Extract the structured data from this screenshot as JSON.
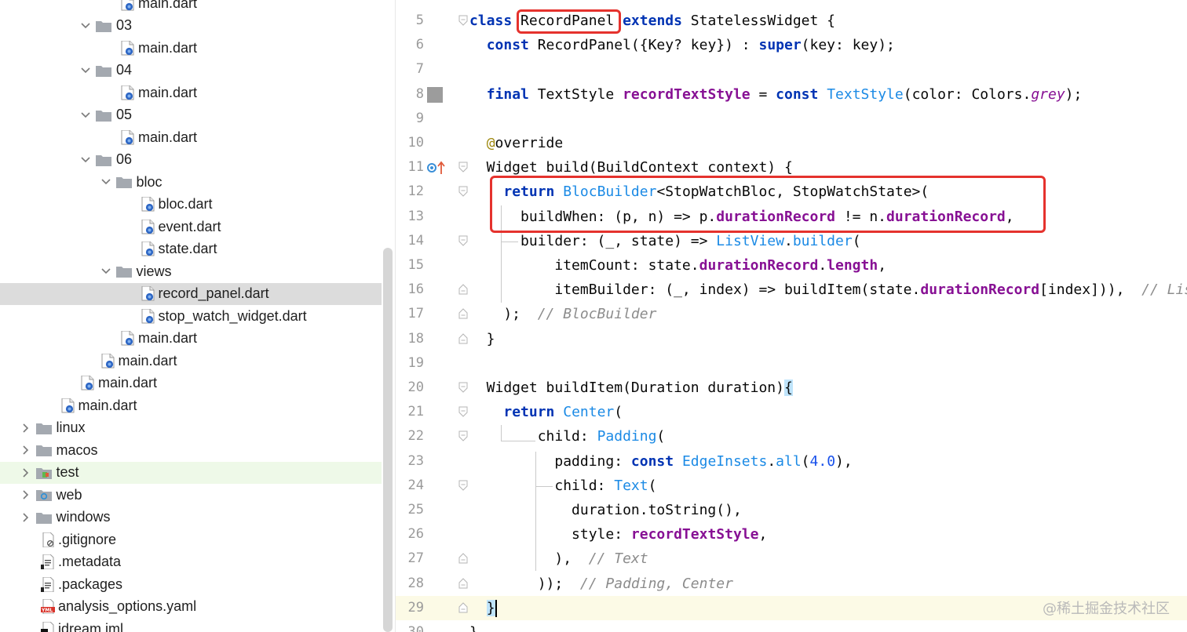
{
  "project_tree": {
    "items": [
      {
        "label": "main.dart",
        "type": "dart",
        "depth": 6
      },
      {
        "label": "03",
        "type": "folder",
        "depth": 4,
        "expanded": true
      },
      {
        "label": "main.dart",
        "type": "dart",
        "depth": 6
      },
      {
        "label": "04",
        "type": "folder",
        "depth": 4,
        "expanded": true
      },
      {
        "label": "main.dart",
        "type": "dart",
        "depth": 6
      },
      {
        "label": "05",
        "type": "folder",
        "depth": 4,
        "expanded": true
      },
      {
        "label": "main.dart",
        "type": "dart",
        "depth": 6
      },
      {
        "label": "06",
        "type": "folder",
        "depth": 4,
        "expanded": true
      },
      {
        "label": "bloc",
        "type": "folder",
        "depth": 5,
        "expanded": true
      },
      {
        "label": "bloc.dart",
        "type": "dart",
        "depth": 7
      },
      {
        "label": "event.dart",
        "type": "dart",
        "depth": 7
      },
      {
        "label": "state.dart",
        "type": "dart",
        "depth": 7
      },
      {
        "label": "views",
        "type": "folder",
        "depth": 5,
        "expanded": true
      },
      {
        "label": "record_panel.dart",
        "type": "dart",
        "depth": 7,
        "selected": true
      },
      {
        "label": "stop_watch_widget.dart",
        "type": "dart",
        "depth": 7
      },
      {
        "label": "main.dart",
        "type": "dart",
        "depth": 6
      },
      {
        "label": "main.dart",
        "type": "dart",
        "depth": 5
      },
      {
        "label": "main.dart",
        "type": "dart",
        "depth": 4
      },
      {
        "label": "main.dart",
        "type": "dart",
        "depth": 3
      },
      {
        "label": "linux",
        "type": "folder",
        "depth": 1,
        "expanded": false
      },
      {
        "label": "macos",
        "type": "folder",
        "depth": 1,
        "expanded": false
      },
      {
        "label": "test",
        "type": "test-folder",
        "depth": 1,
        "expanded": false,
        "highlighted": true
      },
      {
        "label": "web",
        "type": "web-folder",
        "depth": 1,
        "expanded": false
      },
      {
        "label": "windows",
        "type": "folder",
        "depth": 1,
        "expanded": false
      },
      {
        "label": ".gitignore",
        "type": "ignore-file",
        "depth": 2
      },
      {
        "label": ".metadata",
        "type": "text-file",
        "depth": 2
      },
      {
        "label": ".packages",
        "type": "text-file",
        "depth": 2
      },
      {
        "label": "analysis_options.yaml",
        "type": "yaml-file",
        "depth": 2
      },
      {
        "label": "idream.iml",
        "type": "iml-file",
        "depth": 2
      }
    ]
  },
  "editor": {
    "current_line": "29",
    "lines": [
      {
        "num": "5",
        "tokens": [
          [
            "kw",
            "class"
          ],
          [
            "p",
            " "
          ],
          [
            "p",
            "RecordPanel"
          ],
          [
            "p",
            " "
          ],
          [
            "kw",
            "extends"
          ],
          [
            "p",
            " StatelessWidget {"
          ]
        ]
      },
      {
        "num": "6",
        "tokens": [
          [
            "p",
            "  "
          ],
          [
            "kw",
            "const"
          ],
          [
            "p",
            " RecordPanel({Key? key}) : "
          ],
          [
            "kw",
            "super"
          ],
          [
            "p",
            "(key: key);"
          ]
        ]
      },
      {
        "num": "7",
        "tokens": []
      },
      {
        "num": "8",
        "tokens": [
          [
            "p",
            "  "
          ],
          [
            "kw",
            "final"
          ],
          [
            "p",
            " TextStyle "
          ],
          [
            "field",
            "recordTextStyle"
          ],
          [
            "p",
            " = "
          ],
          [
            "kw",
            "const"
          ],
          [
            "p",
            " "
          ],
          [
            "blue",
            "TextStyle"
          ],
          [
            "p",
            "(color: Colors."
          ],
          [
            "ital",
            "grey"
          ],
          [
            "p",
            ");"
          ]
        ]
      },
      {
        "num": "9",
        "tokens": []
      },
      {
        "num": "10",
        "tokens": [
          [
            "p",
            "  "
          ],
          [
            "ann",
            "@"
          ],
          [
            "p",
            "override"
          ]
        ]
      },
      {
        "num": "11",
        "tokens": [
          [
            "p",
            "  Widget build(BuildContext context) {"
          ]
        ]
      },
      {
        "num": "12",
        "tokens": [
          [
            "p",
            "    "
          ],
          [
            "kw",
            "return"
          ],
          [
            "p",
            " "
          ],
          [
            "blue",
            "BlocBuilder"
          ],
          [
            "p",
            "<StopWatchBloc, StopWatchState>("
          ]
        ]
      },
      {
        "num": "13",
        "tokens": [
          [
            "p",
            "      buildWhen: (p, n) => p."
          ],
          [
            "field",
            "durationRecord"
          ],
          [
            "p",
            " != n."
          ],
          [
            "field",
            "durationRecord"
          ],
          [
            "p",
            ","
          ]
        ]
      },
      {
        "num": "14",
        "tokens": [
          [
            "p",
            "      builder: (_, state) => "
          ],
          [
            "blue",
            "ListView"
          ],
          [
            "p",
            "."
          ],
          [
            "blue",
            "builder"
          ],
          [
            "p",
            "("
          ]
        ]
      },
      {
        "num": "15",
        "tokens": [
          [
            "p",
            "          itemCount: state."
          ],
          [
            "field",
            "durationRecord"
          ],
          [
            "p",
            "."
          ],
          [
            "field",
            "length"
          ],
          [
            "p",
            ","
          ]
        ]
      },
      {
        "num": "16",
        "tokens": [
          [
            "p",
            "          itemBuilder: (_, index) => buildItem(state."
          ],
          [
            "field",
            "durationRecord"
          ],
          [
            "p",
            "[index])),  "
          ],
          [
            "com",
            "// ListView"
          ]
        ]
      },
      {
        "num": "17",
        "tokens": [
          [
            "p",
            "    );  "
          ],
          [
            "com",
            "// BlocBuilder"
          ]
        ]
      },
      {
        "num": "18",
        "tokens": [
          [
            "p",
            "  }"
          ]
        ]
      },
      {
        "num": "19",
        "tokens": []
      },
      {
        "num": "20",
        "tokens": [
          [
            "p",
            "  Widget buildItem(Duration duration)"
          ],
          [
            "brace",
            "{"
          ]
        ]
      },
      {
        "num": "21",
        "tokens": [
          [
            "p",
            "    "
          ],
          [
            "kw",
            "return"
          ],
          [
            "p",
            " "
          ],
          [
            "blue",
            "Center"
          ],
          [
            "p",
            "("
          ]
        ]
      },
      {
        "num": "22",
        "tokens": [
          [
            "p",
            "        child: "
          ],
          [
            "blue",
            "Padding"
          ],
          [
            "p",
            "("
          ]
        ]
      },
      {
        "num": "23",
        "tokens": [
          [
            "p",
            "          padding: "
          ],
          [
            "kw",
            "const"
          ],
          [
            "p",
            " "
          ],
          [
            "blue",
            "EdgeInsets"
          ],
          [
            "p",
            "."
          ],
          [
            "blue",
            "all"
          ],
          [
            "p",
            "("
          ],
          [
            "num",
            "4.0"
          ],
          [
            "p",
            "),"
          ]
        ]
      },
      {
        "num": "24",
        "tokens": [
          [
            "p",
            "          child: "
          ],
          [
            "blue",
            "Text"
          ],
          [
            "p",
            "("
          ]
        ]
      },
      {
        "num": "25",
        "tokens": [
          [
            "p",
            "            duration.toString(),"
          ]
        ]
      },
      {
        "num": "26",
        "tokens": [
          [
            "p",
            "            style: "
          ],
          [
            "field",
            "recordTextStyle"
          ],
          [
            "p",
            ","
          ]
        ]
      },
      {
        "num": "27",
        "tokens": [
          [
            "p",
            "          ),  "
          ],
          [
            "com",
            "// Text"
          ]
        ]
      },
      {
        "num": "28",
        "tokens": [
          [
            "p",
            "        ));  "
          ],
          [
            "com",
            "// Padding, Center"
          ]
        ]
      },
      {
        "num": "29",
        "tokens": [
          [
            "p",
            "  "
          ],
          [
            "brace",
            "}"
          ]
        ]
      },
      {
        "num": "30",
        "tokens": [
          [
            "p",
            "}"
          ]
        ]
      }
    ]
  },
  "watermark": "@稀土掘金技术社区",
  "colors": {
    "keyword": "#0033b3",
    "class_ref": "#1b8ae5",
    "field": "#871094",
    "comment": "#8c8c8c",
    "annotation": "#9e880d",
    "number": "#1750eb",
    "highlight_box": "#e5322d",
    "selection": "#dcdcdc",
    "current_line": "#fcfae6"
  }
}
